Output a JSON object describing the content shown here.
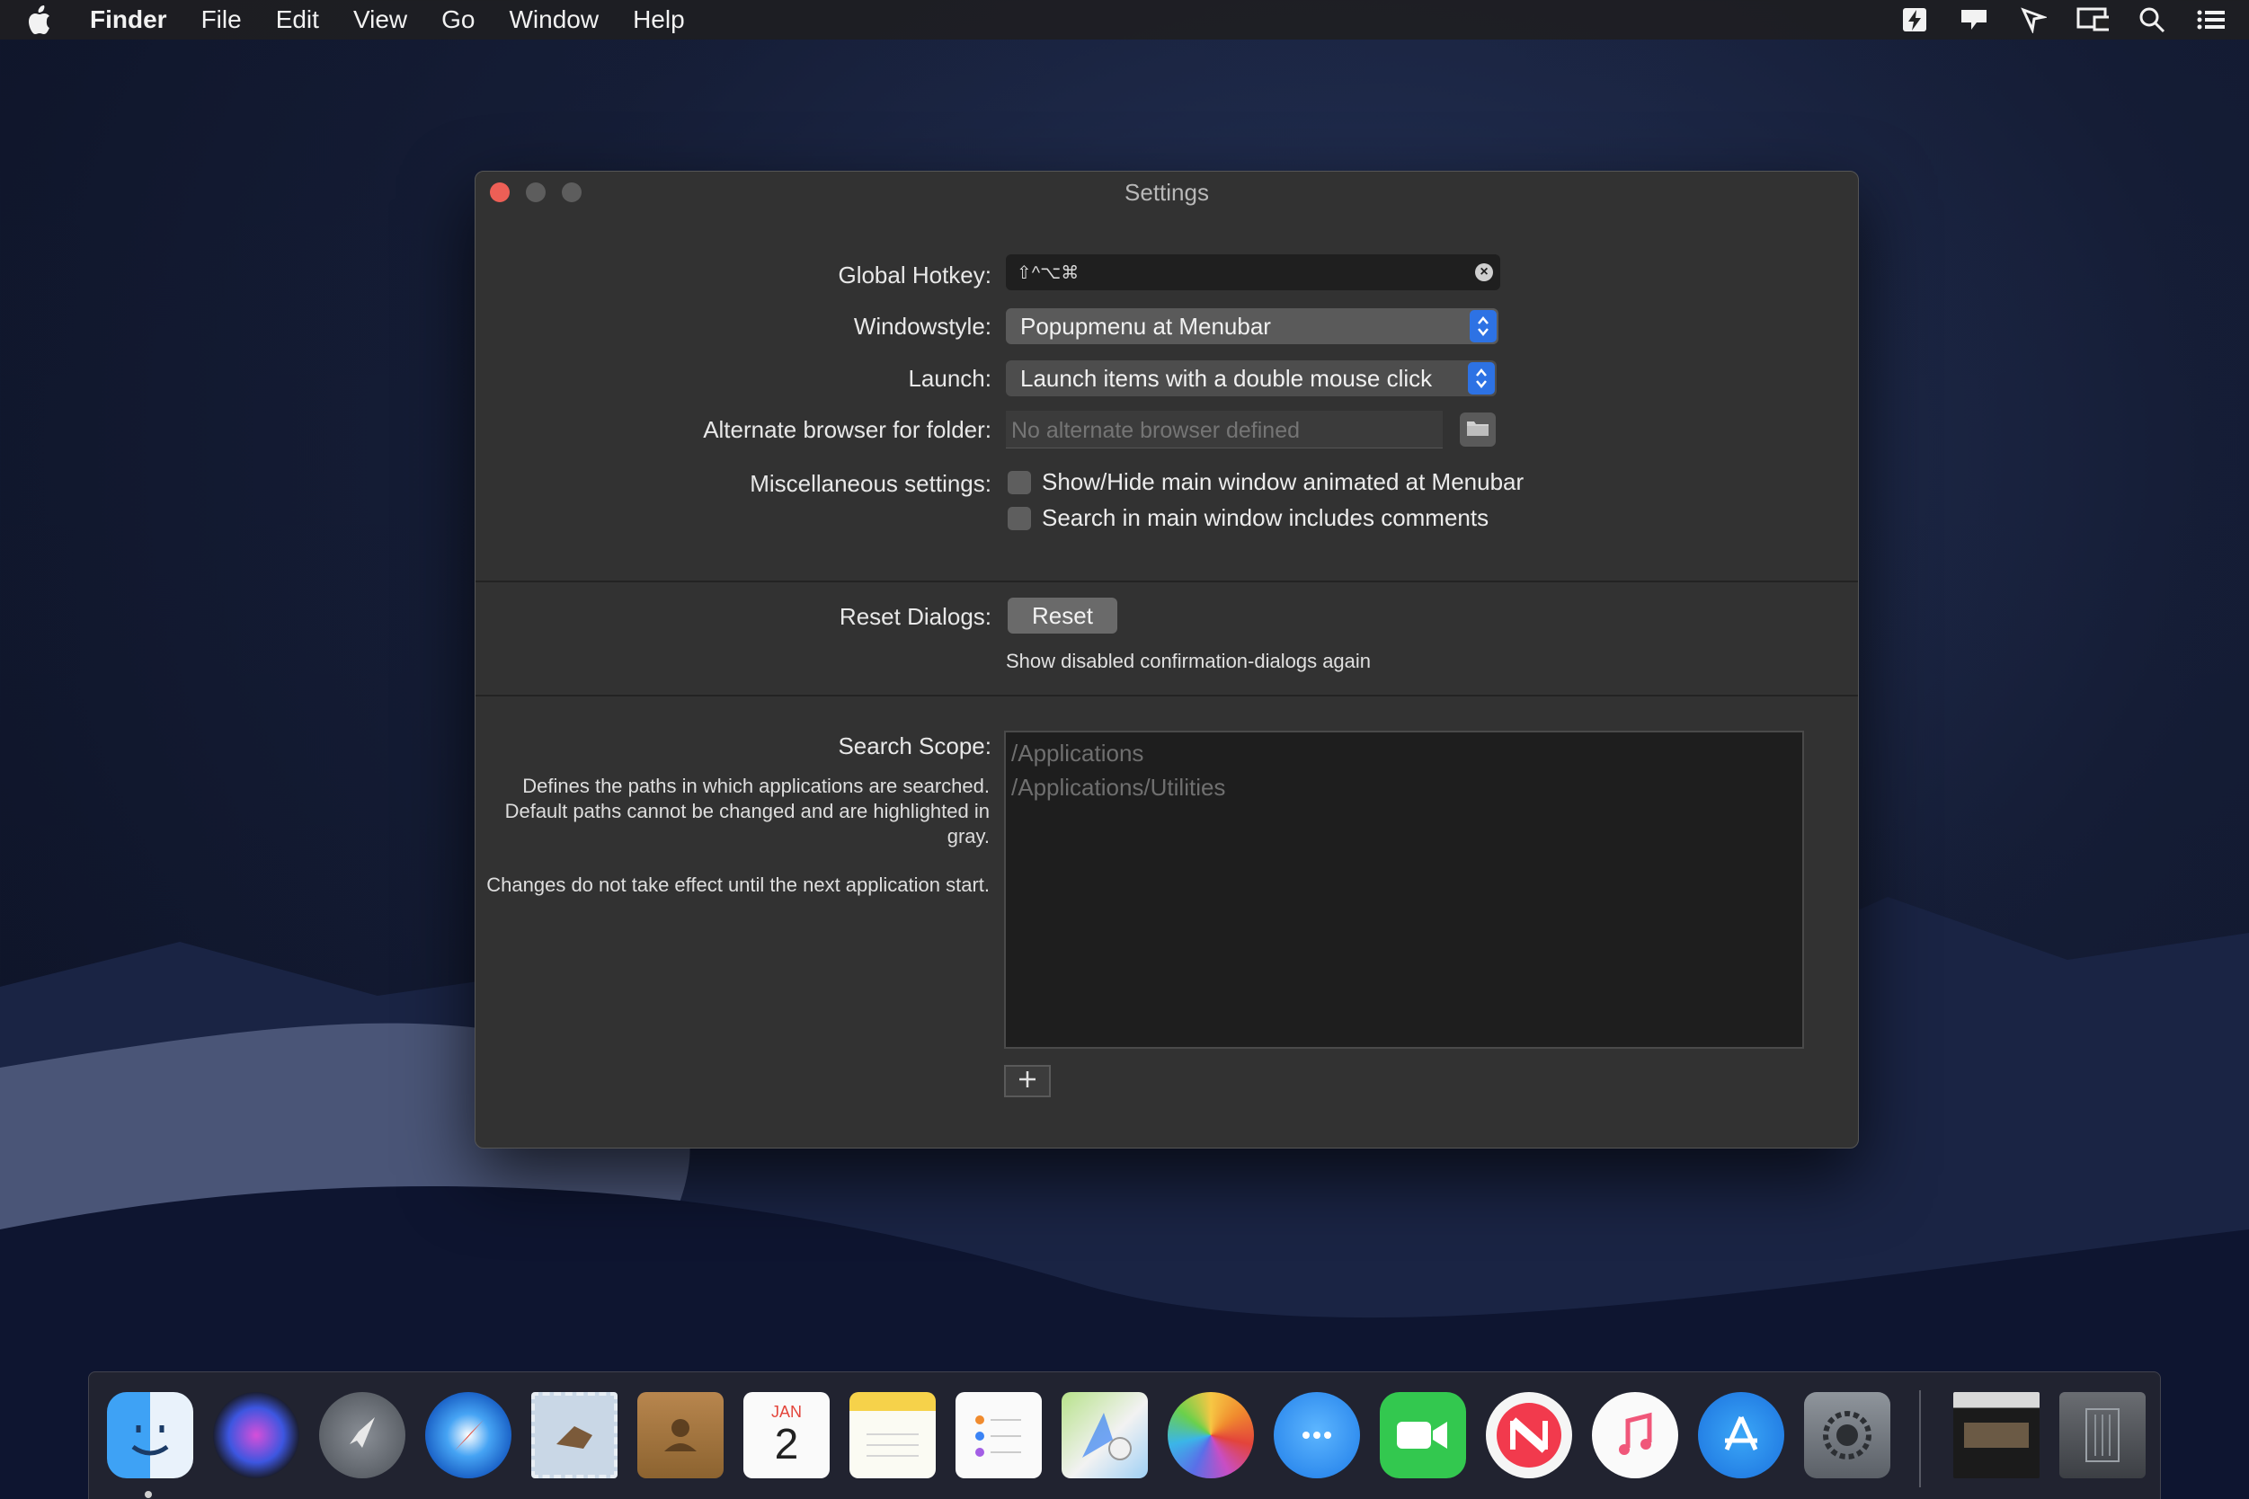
{
  "menubar": {
    "app_name": "Finder",
    "items": [
      "File",
      "Edit",
      "View",
      "Go",
      "Window",
      "Help"
    ]
  },
  "window": {
    "title": "Settings",
    "global_hotkey": {
      "label": "Global Hotkey:",
      "value": "⇧^⌥⌘"
    },
    "windowstyle": {
      "label": "Windowstyle:",
      "value": "Popupmenu at Menubar"
    },
    "launch": {
      "label": "Launch:",
      "value": "Launch items with a double mouse click"
    },
    "alternate_browser": {
      "label": "Alternate browser for folder:",
      "placeholder": "No alternate browser defined"
    },
    "misc": {
      "label": "Miscellaneous settings:",
      "options": [
        {
          "label": "Show/Hide main window animated at Menubar",
          "checked": false
        },
        {
          "label": "Search in main window includes comments",
          "checked": false
        }
      ]
    },
    "reset_dialogs": {
      "label": "Reset Dialogs:",
      "button": "Reset",
      "note": "Show disabled confirmation-dialogs again"
    },
    "search_scope": {
      "label": "Search Scope:",
      "description1": "Defines the paths in which applications are searched. Default paths cannot be changed and are highlighted in gray.",
      "description2": "Changes do not take effect until the next application start.",
      "paths": [
        "/Applications",
        "/Applications/Utilities"
      ],
      "add_button": "+"
    }
  },
  "dock": {
    "calendar_month": "JAN",
    "calendar_day": "2"
  },
  "colors": {
    "accent": "#2d72e4",
    "close": "#ed5f56",
    "window_bg": "#323232"
  }
}
